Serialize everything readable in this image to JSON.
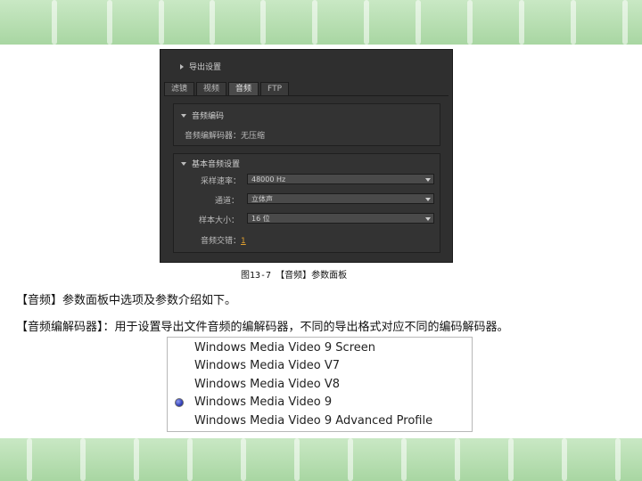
{
  "panel": {
    "export_settings": "导出设置",
    "tabs": [
      {
        "label": "滤镜"
      },
      {
        "label": "视频"
      },
      {
        "label": "音频"
      },
      {
        "label": "FTP"
      }
    ],
    "active_tab": 2,
    "audio_codec": {
      "title": "音频编码",
      "codec_label": "音频编解码器：",
      "codec_value": "无压缩"
    },
    "basic_audio": {
      "title": "基本音频设置",
      "sample_rate_label": "采样速率：",
      "sample_rate_value": "48000 Hz",
      "channels_label": "通道：",
      "channels_value": "立体声",
      "sample_size_label": "样本大小：",
      "sample_size_value": "16 位",
      "interleave_label": "音频交错：",
      "interleave_value": "1"
    }
  },
  "caption": "图13-7　【音频】参数面板",
  "paragraphs": [
    "【音频】参数面板中选项及参数介绍如下。",
    "【音频编解码器】：用于设置导出文件音频的编解码器，不同的导出格式对应不同的编码解码器。"
  ],
  "codec_list": {
    "items": [
      "Windows Media Video 9 Screen",
      "Windows Media Video V7",
      "Windows Media Video V8",
      "Windows Media Video 9",
      "Windows Media Video 9 Advanced Profile"
    ],
    "selected_index": 3
  },
  "colors": {
    "band": "#a8d6a2",
    "panel_bg": "#2f2f2f",
    "link": "#e0a030"
  }
}
